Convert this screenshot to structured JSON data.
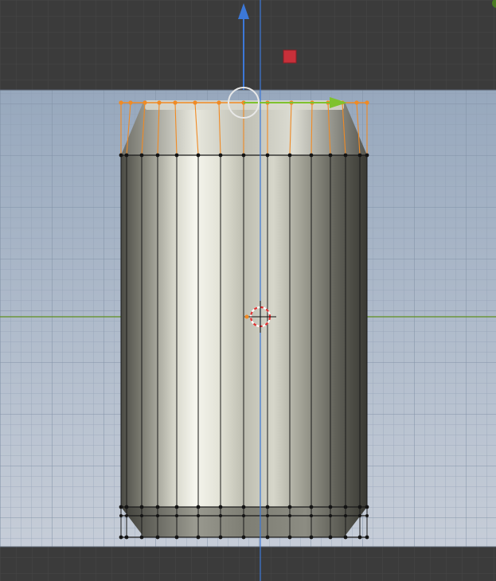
{
  "viewport": {
    "mode": "edit-mode-front-view",
    "object": "soda-can-mesh",
    "colors": {
      "dark_grid_bg": "#3b3b3b",
      "dark_grid_line": "#484848",
      "light_grid_top": "#9aaabe",
      "light_grid_bottom": "#c3cbd6",
      "light_grid_line": "#8e9db1",
      "x_axis": "#5f8f1f",
      "z_axis": "#3c78d8",
      "selected_vertex": "#f08a24",
      "vertex": "#141414",
      "edge": "#1a1a1a",
      "gizmo_ring": "#e8e8e8",
      "gizmo_handle": "#c8303a",
      "cursor_ring": "#e03030"
    },
    "gizmo": {
      "up_arrow_icon": "arrow-up-icon",
      "right_arrow_icon": "arrow-right-icon",
      "handle_icon": "square-handle-icon",
      "ring_icon": "circle-ring-icon"
    },
    "icons": {
      "cursor": "3d-cursor-icon",
      "corner": "viewport-corner-icon"
    }
  }
}
